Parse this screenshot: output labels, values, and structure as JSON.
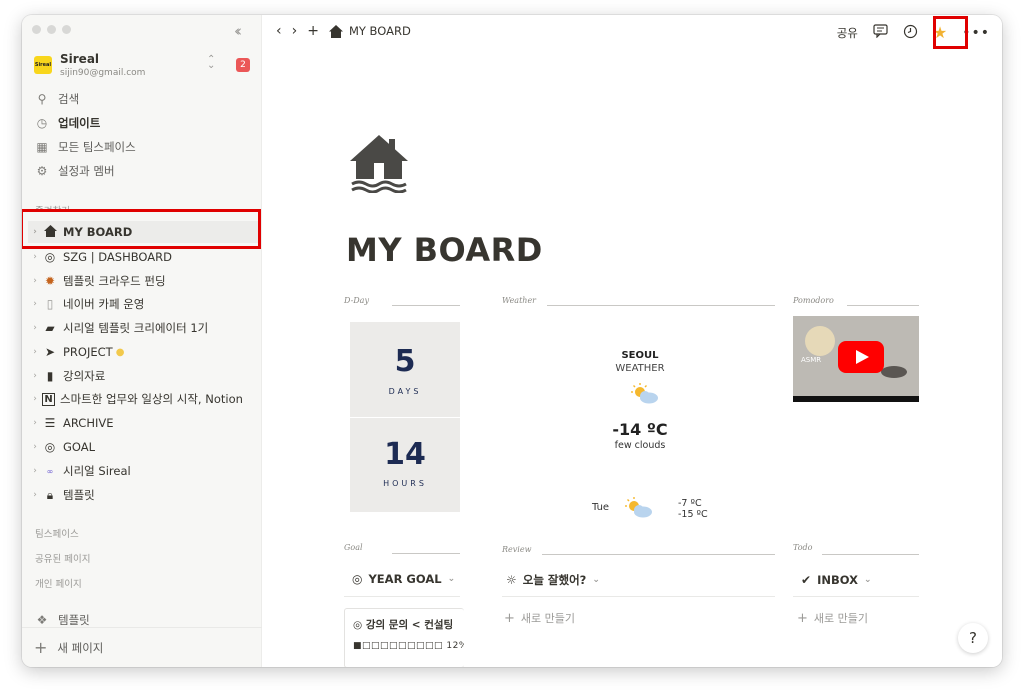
{
  "sidebar": {
    "workspace": {
      "logo_text": "Sireal",
      "name": "Sireal",
      "email": "sijin90@gmail.com",
      "badge": "2"
    },
    "nav": [
      {
        "label": "검색",
        "icon": "search-icon"
      },
      {
        "label": "업데이트",
        "icon": "clock-icon"
      },
      {
        "label": "모든 팀스페이스",
        "icon": "building-icon"
      },
      {
        "label": "설정과 멤버",
        "icon": "gear-icon"
      }
    ],
    "favorites_label": "즐겨찾기",
    "favorites": [
      {
        "label": "MY BOARD",
        "icon": "house-icon"
      },
      {
        "label": "SZG | DASHBOARD",
        "icon": "target-icon"
      },
      {
        "label": "템플릿 크라우드 펀딩",
        "icon": "firework-icon"
      },
      {
        "label": "네이버 카페 운영",
        "icon": "page-icon"
      },
      {
        "label": "시리얼 템플릿 크리에이터 1기",
        "icon": "folder-icon"
      },
      {
        "label": "PROJECT",
        "icon": "paper-plane-icon"
      },
      {
        "label": "강의자료",
        "icon": "book-icon"
      },
      {
        "label": "스마트한 업무와 일상의 시작, Notion",
        "icon": "notion-icon"
      },
      {
        "label": "ARCHIVE",
        "icon": "database-icon"
      },
      {
        "label": "GOAL",
        "icon": "target-icon"
      },
      {
        "label": "시리얼 Sireal",
        "icon": "sireal-logo-icon"
      },
      {
        "label": "템플릿",
        "icon": "lock-icon"
      }
    ],
    "sections": {
      "teamspace": "팀스페이스",
      "shared": "공유된 페이지",
      "private": "개인 페이지"
    },
    "template_label": "템플릿",
    "new_page_label": "새 페이지"
  },
  "topbar": {
    "title": "MY BOARD",
    "share_label": "공유"
  },
  "page": {
    "title": "MY BOARD",
    "widget_headers": {
      "dday": "D-Day",
      "weather": "Weather",
      "pomodoro": "Pomodoro",
      "goal": "Goal",
      "review": "Review",
      "todo": "Todo"
    },
    "dday": {
      "days_value": "5",
      "days_label": "DAYS",
      "hours_value": "14",
      "hours_label": "HOURS"
    },
    "weather": {
      "city": "SEOUL",
      "label": "WEATHER",
      "temp": "-14 ºC",
      "condition": "few clouds",
      "forecast_day": "Tue",
      "forecast_hi": "-7 ºC",
      "forecast_lo": "-15 ºC"
    },
    "video": {
      "caption": "ASMR"
    },
    "goal_view": {
      "label": "YEAR GOAL"
    },
    "review_view": {
      "label": "오늘 잘했어?",
      "add_label": "새로 만들기"
    },
    "todo_view": {
      "label": "INBOX",
      "add_label": "새로 만들기"
    },
    "goal_card": {
      "title": "강의 문의 < 컨설팅",
      "progress_text": "■□□□□□□□□□ 12%"
    }
  },
  "colors": {
    "highlight": "#e00000",
    "dday_text": "#1d2b53",
    "badge": "#eb5757"
  }
}
